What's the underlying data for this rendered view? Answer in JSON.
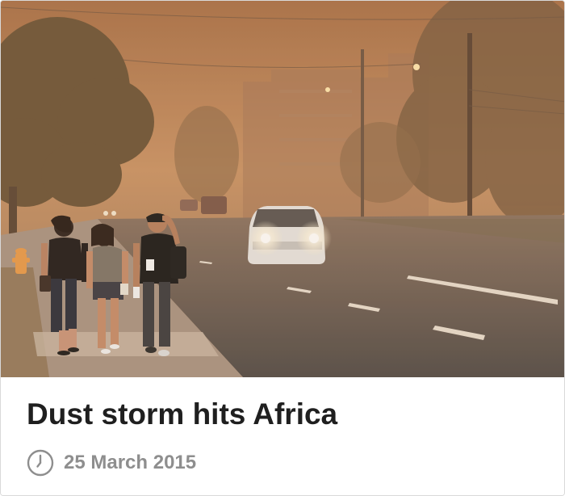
{
  "article": {
    "headline": "Dust storm hits Africa",
    "date": "25 March 2015",
    "image_icon": "photo",
    "date_icon": "clock-icon"
  },
  "colors": {
    "headline": "#1f1f1f",
    "date": "#8e8e8e",
    "dust_sky": "#c08a5c",
    "road": "#5f544e"
  }
}
